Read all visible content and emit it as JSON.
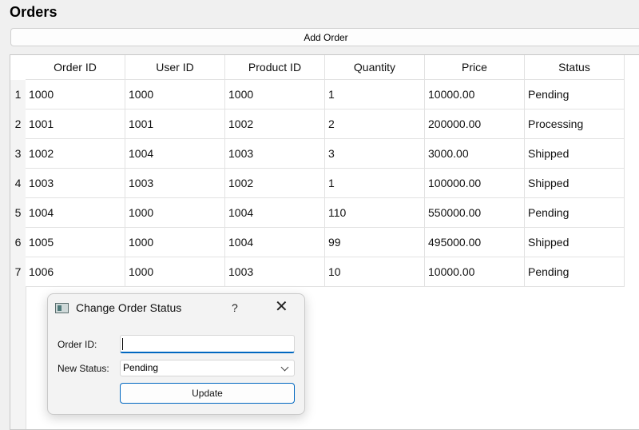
{
  "page": {
    "title": "Orders"
  },
  "toolbar": {
    "add_order_label": "Add Order"
  },
  "table": {
    "columns": [
      "Order ID",
      "User ID",
      "Product ID",
      "Quantity",
      "Price",
      "Status"
    ],
    "rows": [
      {
        "num": "1",
        "cells": [
          "1000",
          "1000",
          "1000",
          "1",
          "10000.00",
          "Pending"
        ]
      },
      {
        "num": "2",
        "cells": [
          "1001",
          "1001",
          "1002",
          "2",
          "200000.00",
          "Processing"
        ]
      },
      {
        "num": "3",
        "cells": [
          "1002",
          "1004",
          "1003",
          "3",
          "3000.00",
          "Shipped"
        ]
      },
      {
        "num": "4",
        "cells": [
          "1003",
          "1003",
          "1002",
          "1",
          "100000.00",
          "Shipped"
        ]
      },
      {
        "num": "5",
        "cells": [
          "1004",
          "1000",
          "1004",
          "110",
          "550000.00",
          "Pending"
        ]
      },
      {
        "num": "6",
        "cells": [
          "1005",
          "1000",
          "1004",
          "99",
          "495000.00",
          "Shipped"
        ]
      },
      {
        "num": "7",
        "cells": [
          "1006",
          "1000",
          "1003",
          "10",
          "10000.00",
          "Pending"
        ]
      }
    ]
  },
  "dialog": {
    "title": "Change Order Status",
    "help_glyph": "?",
    "close_glyph": "✕",
    "order_id_label": "Order ID:",
    "order_id_value": "",
    "new_status_label": "New Status:",
    "new_status_value": "Pending",
    "update_label": "Update",
    "icons": {
      "window": "app-window-icon",
      "help": "help-icon",
      "close": "close-icon",
      "dropdown": "chevron-down-icon"
    }
  },
  "colors": {
    "accent": "#0067c0",
    "window_bg": "#f0f0f0",
    "grid_line": "#e2e2e2"
  }
}
